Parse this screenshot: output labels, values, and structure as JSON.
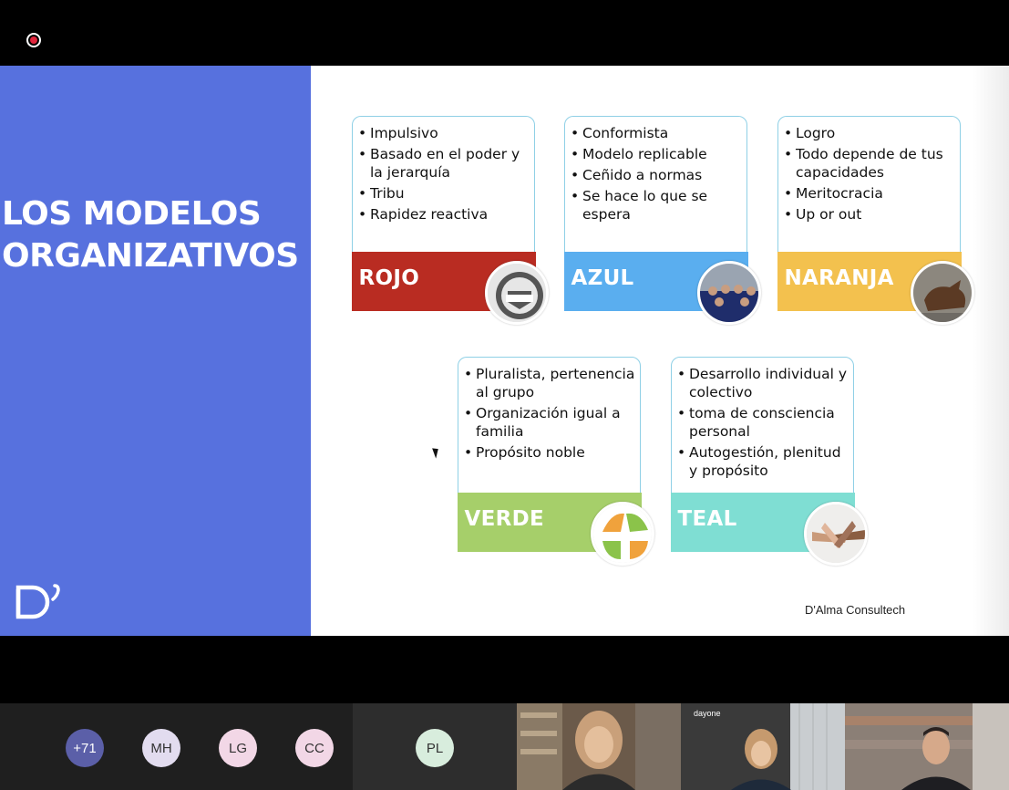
{
  "slide": {
    "title_lines": [
      "LOS MODELOS",
      "ORGANIZATIVOS"
    ],
    "footer": "D'Alma Consultech",
    "colors": {
      "left_panel": "#5771de",
      "card_border": "#8fd0e6"
    },
    "cards": [
      {
        "items": [
          "Impulsivo",
          "Basado en el poder y la jerarquía",
          "Tribu",
          "Rapidez reactiva"
        ],
        "label": "ROJO",
        "color": "#b92c22",
        "image": "the-squad-badge"
      },
      {
        "items": [
          "Conformista",
          "Modelo replicable",
          "Ceñido a normas",
          "Se hace lo que se espera"
        ],
        "label": "AZUL",
        "color": "#5aaeef",
        "image": "uniformed-group-photo"
      },
      {
        "items": [
          "Logro",
          "Todo depende de tus capacidades",
          "Meritocracia",
          "Up or out"
        ],
        "label": "NARANJA",
        "color": "#f3c14e",
        "image": "wall-street-bull"
      },
      {
        "items": [
          "Pluralista, pertenencia al grupo",
          "Organización igual a familia",
          "Propósito noble"
        ],
        "label": "VERDE",
        "color": "#a6cf6a",
        "image": "family-care-icons"
      },
      {
        "items": [
          "Desarrollo individual y colectivo",
          "toma de consciencia personal",
          "Autogestión, plenitud y propósito"
        ],
        "label": "TEAL",
        "color": "#7fded3",
        "image": "stacked-hands-photo"
      }
    ]
  },
  "participants": {
    "avatars": [
      {
        "initials": "+71",
        "color": "#5b5fa8",
        "text_color": "#ffffff"
      },
      {
        "initials": "MH",
        "color": "#e2dcef",
        "text_color": "#333333"
      },
      {
        "initials": "LG",
        "color": "#f2d7e6",
        "text_color": "#333333"
      },
      {
        "initials": "CC",
        "color": "#f2d7e6",
        "text_color": "#333333"
      }
    ],
    "active_speaker": {
      "initials": "PL",
      "color": "#d8eddd"
    },
    "video_brand": "dayone"
  }
}
